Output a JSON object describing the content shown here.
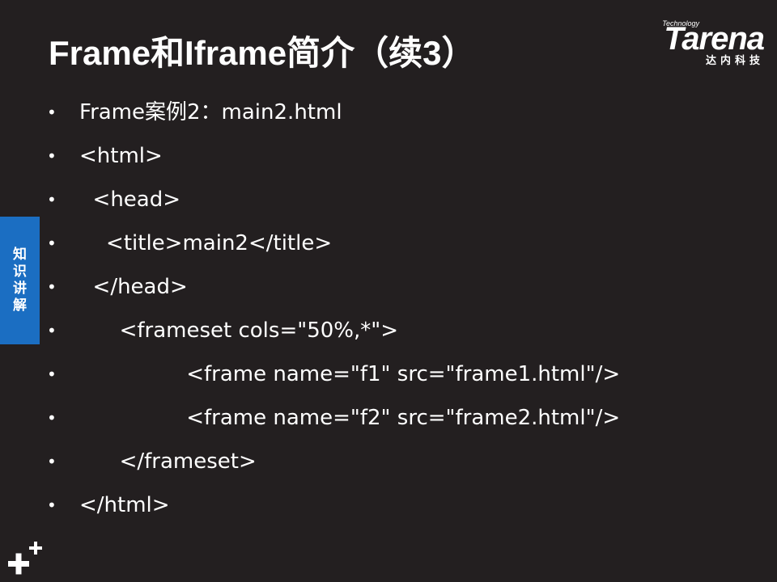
{
  "title": "Frame和Iframe简介（续3）",
  "logo": {
    "tagline": "Technology",
    "wordmark": "Tarena",
    "chinese": "达内科技"
  },
  "side_tab": {
    "label": "知识讲解"
  },
  "bullet_marker": "•",
  "bullets": [
    {
      "text": "Frame案例2：main2.html"
    },
    {
      "text": "<html>"
    },
    {
      "text": "  <head>"
    },
    {
      "text": "    <title>main2</title>"
    },
    {
      "text": "  </head>"
    },
    {
      "text": "      <frameset cols=\"50%,*\">"
    },
    {
      "text": "                <frame name=\"f1\" src=\"frame1.html\"/>"
    },
    {
      "text": "                <frame name=\"f2\" src=\"frame2.html\"/>"
    },
    {
      "text": "      </frameset>"
    },
    {
      "text": "</html>"
    }
  ],
  "colors": {
    "background": "#231f20",
    "text": "#ffffff",
    "side_tab": "#1b6ec2"
  }
}
